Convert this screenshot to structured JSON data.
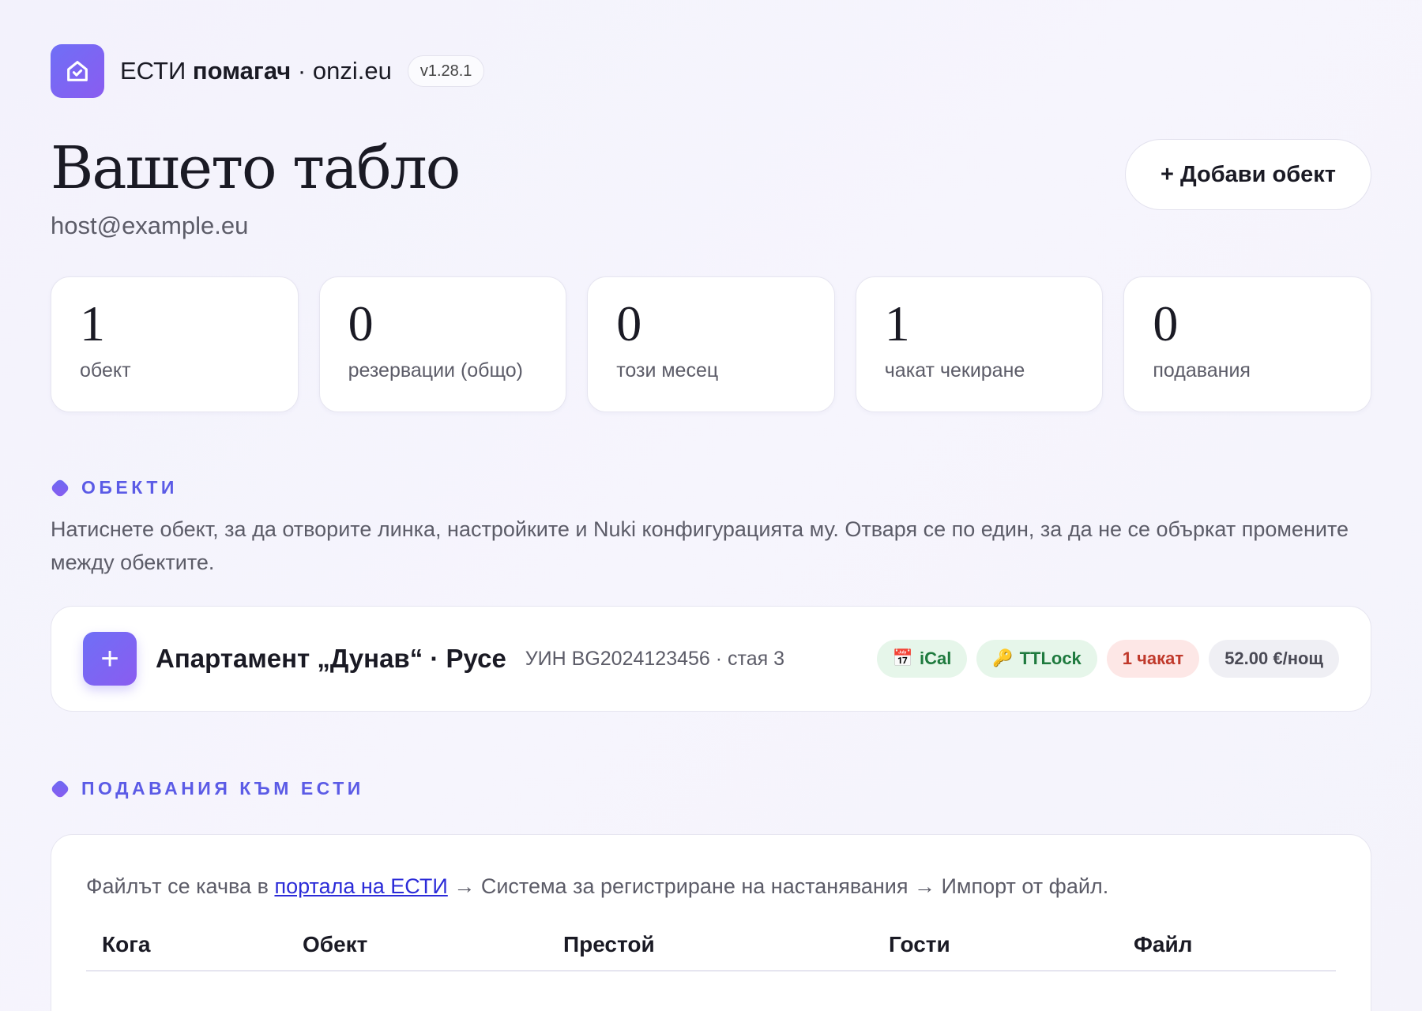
{
  "header": {
    "brand_prefix": "ЕСТИ",
    "brand_bold": "помагач",
    "brand_suffix": "· onzi.eu",
    "version": "v1.28.1",
    "logo_icon": "house-check-icon"
  },
  "dashboard": {
    "title": "Вашето табло",
    "user_email": "host@example.eu",
    "add_button": "+ Добави обект"
  },
  "stats": [
    {
      "value": "1",
      "label": "обект"
    },
    {
      "value": "0",
      "label": "резервации (общо)"
    },
    {
      "value": "0",
      "label": "този месец"
    },
    {
      "value": "1",
      "label": "чакат чекиране"
    },
    {
      "value": "0",
      "label": "подавания"
    }
  ],
  "objects_section": {
    "title": "ОБЕКТИ",
    "description": "Натиснете обект, за да отворите линка, настройките и Nuki конфигурацията му. Отваря се по един, за да не се объркат промените между обектите."
  },
  "property": {
    "name": "Апартамент „Дунав“ · Русе",
    "uin": "УИН BG2024123456 · стая 3",
    "badges": {
      "ical": "iCal",
      "ical_icon": "calendar-icon",
      "ttlock": "TTLock",
      "ttlock_icon": "key-icon",
      "pending": "1 чакат",
      "price": "52.00 €/нощ"
    }
  },
  "submissions_section": {
    "title": "ПОДАВАНИЯ КЪМ ЕСТИ",
    "note_prefix": "Файлът се качва в",
    "note_link": "портала на ЕСТИ",
    "note_suffix": "→ Система за регистриране на настанявания → Импорт от файл.",
    "columns": [
      "Кога",
      "Обект",
      "Престой",
      "Гости",
      "Файл"
    ]
  },
  "colors": {
    "accent": "#5b5be6",
    "accent_gradient_start": "#6f6ff6",
    "accent_gradient_end": "#8a5cf0",
    "badge_green_bg": "#e6f6ea",
    "badge_green_text": "#1e7a3e",
    "badge_red_bg": "#fde7e6",
    "badge_red_text": "#c0392b"
  }
}
